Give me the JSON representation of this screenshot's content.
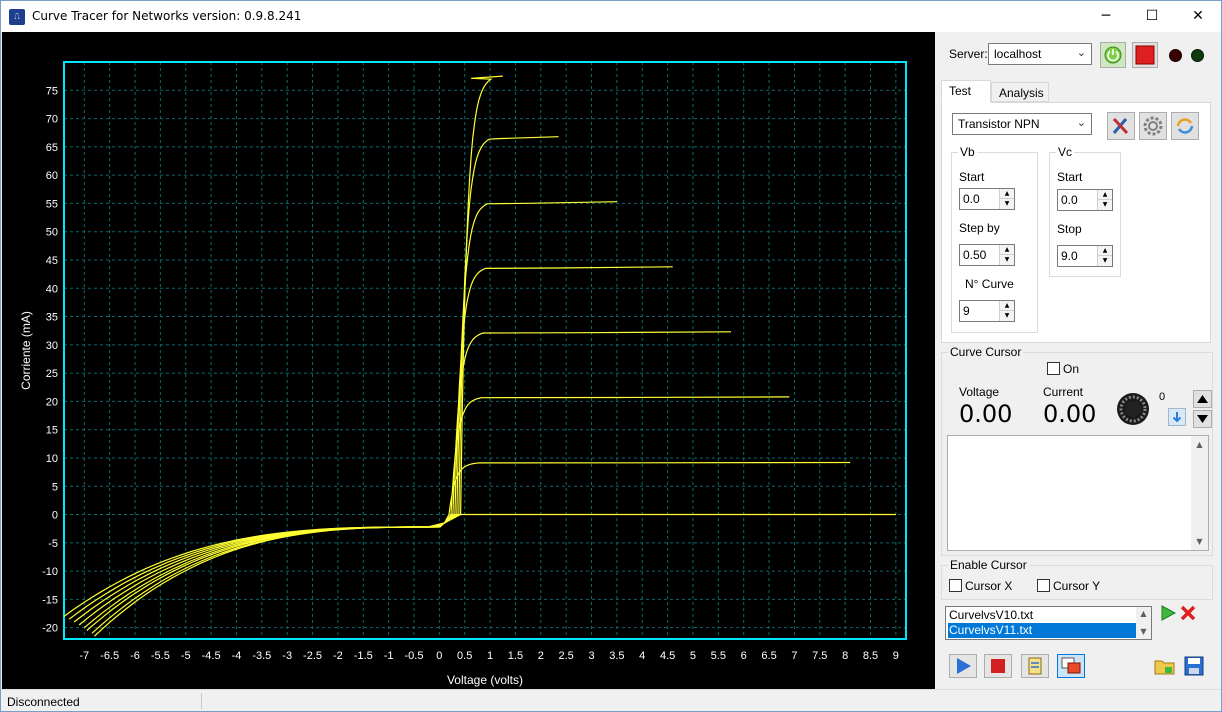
{
  "window": {
    "title": "Curve Tracer for Networks  version: 0.9.8.241",
    "app_icon": "app-icon",
    "minimize": "─",
    "maximize": "☐",
    "close": "✕"
  },
  "server": {
    "label": "Server:",
    "value": "localhost",
    "power_icon": "power-icon",
    "stop_icon": "stop-icon",
    "led_red": "#3a0000",
    "led_green": "#0f3a0f"
  },
  "tabs": [
    {
      "label": "Test",
      "active": true
    },
    {
      "label": "Analysis",
      "active": false
    }
  ],
  "test": {
    "device_type": "Transistor NPN",
    "vb": {
      "title": "Vb",
      "start_label": "Start",
      "start_value": "0.0",
      "step_label": "Step by",
      "step_value": "0.50",
      "ncurve_label": "N° Curve",
      "ncurve_value": "9"
    },
    "vc": {
      "title": "Vc",
      "start_label": "Start",
      "start_value": "0.0",
      "stop_label": "Stop",
      "stop_value": "9.0"
    }
  },
  "curve_cursor": {
    "title": "Curve Cursor",
    "on_label": "On",
    "voltage_label": "Voltage",
    "current_label": "Current",
    "voltage_value": "0.00",
    "current_value": "0.00",
    "knob_value": "0"
  },
  "enable_cursor": {
    "title": "Enable Cursor",
    "cursor_x": "Cursor X",
    "cursor_y": "Cursor Y"
  },
  "files": [
    {
      "name": "CurvelvsV10.txt",
      "selected": false
    },
    {
      "name": "CurvelvsV11.txt",
      "selected": true
    }
  ],
  "status": {
    "text": "Disconnected"
  },
  "colors": {
    "plot_bg": "#000000",
    "plot_border": "#00e5ff",
    "grid": "#0b6a6a",
    "curve": "#ffff33",
    "axis_text": "#ffffff"
  },
  "chart_data": {
    "type": "line",
    "xlabel": "Voltage (volts)",
    "ylabel": "Corriente (mA)",
    "xlim": [
      -7.4,
      9.2
    ],
    "ylim": [
      -22,
      80
    ],
    "xticks": [
      "-7",
      "-6.5",
      "-6",
      "-5.5",
      "-5",
      "-4.5",
      "-4",
      "-3.5",
      "-3",
      "-2.5",
      "-2",
      "-1.5",
      "-1",
      "-0.5",
      "0",
      "0.5",
      "1",
      "1.5",
      "2",
      "2.5",
      "3",
      "3.5",
      "4",
      "4.5",
      "5",
      "5.5",
      "6",
      "6.5",
      "7",
      "7.5",
      "8",
      "8.5",
      "9"
    ],
    "yticks": [
      "75",
      "70",
      "65",
      "60",
      "55",
      "50",
      "45",
      "40",
      "35",
      "30",
      "25",
      "20",
      "15",
      "10",
      "5",
      "0",
      "-5",
      "-10",
      "-15",
      "-20"
    ],
    "grid": true,
    "legend": "none",
    "series": [
      {
        "plateau": 77.5,
        "x_end": 1.25,
        "neg_end": [
          -7.4,
          -18
        ]
      },
      {
        "plateau": 66.8,
        "x_end": 2.35,
        "neg_end": [
          -7.3,
          -18.5
        ]
      },
      {
        "plateau": 55.3,
        "x_end": 3.5,
        "neg_end": [
          -7.2,
          -19
        ]
      },
      {
        "plateau": 43.8,
        "x_end": 4.6,
        "neg_end": [
          -7.1,
          -19.5
        ]
      },
      {
        "plateau": 32.3,
        "x_end": 5.75,
        "neg_end": [
          -7.0,
          -20
        ]
      },
      {
        "plateau": 20.8,
        "x_end": 6.9,
        "neg_end": [
          -6.95,
          -20.5
        ]
      },
      {
        "plateau": 9.2,
        "x_end": 8.1,
        "neg_end": [
          -6.85,
          -21
        ]
      },
      {
        "plateau": 0.0,
        "x_end": 9.0,
        "neg_end": [
          -6.8,
          -21.5
        ]
      }
    ]
  }
}
